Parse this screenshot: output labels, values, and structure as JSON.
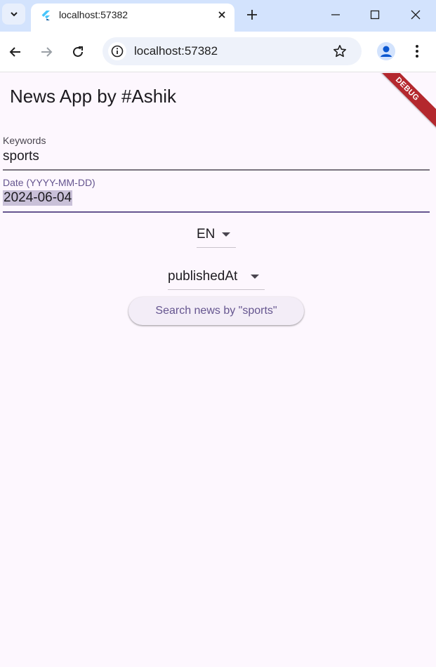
{
  "browser": {
    "tab_title": "localhost:57382",
    "url": "localhost:57382"
  },
  "app": {
    "title": "News App by #Ashik",
    "debug_banner": "DEBUG",
    "keywords_label": "Keywords",
    "keywords_value": "sports",
    "date_label": "Date (YYYY-MM-DD)",
    "date_value": "2024-06-04",
    "language_value": "EN",
    "sort_value": "publishedAt",
    "search_button_label": "Search news by \"sports\""
  },
  "colors": {
    "accent": "#65558f",
    "focus_line": "#65558f",
    "background": "#fdf7fe",
    "debug": "#b4282e"
  }
}
